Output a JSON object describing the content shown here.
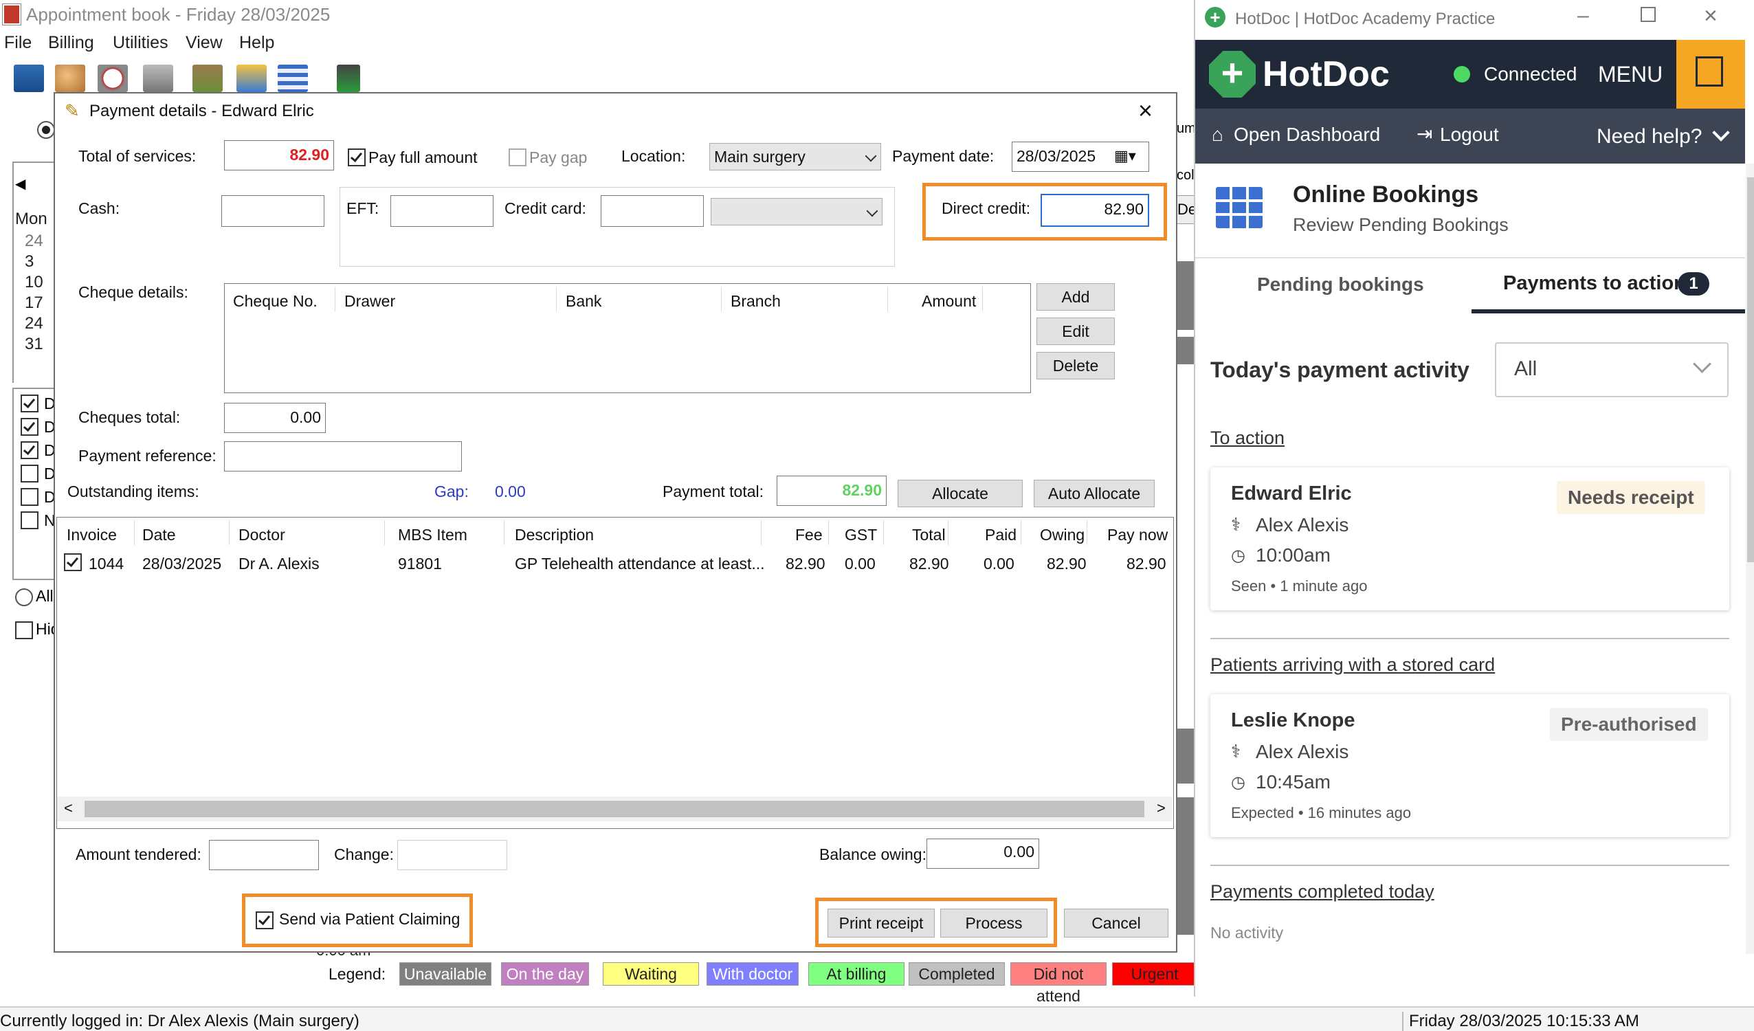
{
  "app": {
    "title": "Appointment book - Friday 28/03/2025",
    "menu": [
      "File",
      "Billing",
      "Utilities",
      "View",
      "Help"
    ],
    "calendar": {
      "day_label": "Mon",
      "dates": [
        "24",
        "3",
        "10",
        "17",
        "24",
        "31"
      ]
    },
    "filters": {
      "item_initial": "D",
      "last_initial": "N",
      "all_label": "All",
      "hide_label": "Hid"
    },
    "right_partial": {
      "a": "umi",
      "b": "colu",
      "c": "De"
    },
    "status_left": "Currently logged in: Dr Alex Alexis (Main surgery)",
    "status_right": "Friday 28/03/2025 10:15:33 AM",
    "legend_label": "Legend:",
    "legend": [
      {
        "label": "Unavailable",
        "bg": "#808080",
        "fg": "#ffffff"
      },
      {
        "label": "On the day",
        "bg": "#c080c0",
        "fg": "#ffffff"
      },
      {
        "label": "Waiting",
        "bg": "#ffff80",
        "fg": "#222222"
      },
      {
        "label": "With doctor",
        "bg": "#8080ff",
        "fg": "#ffffff"
      },
      {
        "label": "At billing",
        "bg": "#80ff80",
        "fg": "#222222"
      },
      {
        "label": "Completed",
        "bg": "#c0c0c0",
        "fg": "#222222"
      },
      {
        "label": "Did not attend",
        "bg": "#ff8080",
        "fg": "#222222"
      },
      {
        "label": "Urgent",
        "bg": "#ff0000",
        "fg": "#222222"
      }
    ],
    "behind_time": "0:00 am"
  },
  "dialog": {
    "title": "Payment details - Edward Elric",
    "total_services_label": "Total of services:",
    "total_services_value": "82.90",
    "pay_full_label": "Pay full amount",
    "pay_gap_label": "Pay gap",
    "location_label": "Location:",
    "location_value": "Main surgery",
    "payment_date_label": "Payment date:",
    "payment_date_value": "28/03/2025",
    "cash_label": "Cash:",
    "eft_label": "EFT:",
    "credit_card_label": "Credit card:",
    "direct_credit_label": "Direct credit:",
    "direct_credit_value": "82.90",
    "cheque_details_label": "Cheque details:",
    "cheque_columns": [
      "Cheque No.",
      "Drawer",
      "Bank",
      "Branch",
      "Amount"
    ],
    "cheque_buttons": {
      "add": "Add",
      "edit": "Edit",
      "delete": "Delete"
    },
    "cheques_total_label": "Cheques total:",
    "cheques_total_value": "0.00",
    "payment_reference_label": "Payment reference:",
    "outstanding_label": "Outstanding items:",
    "gap_label": "Gap:",
    "gap_value": "0.00",
    "payment_total_label": "Payment total:",
    "payment_total_value": "82.90",
    "allocate_label": "Allocate",
    "auto_allocate_label": "Auto Allocate",
    "invoice_columns": [
      "Invoice",
      "Date",
      "Doctor",
      "MBS Item",
      "Description",
      "Fee",
      "GST",
      "Total",
      "Paid",
      "Owing",
      "Pay now"
    ],
    "invoice_rows": [
      {
        "invoice": "1044",
        "date": "28/03/2025",
        "doctor": "Dr A. Alexis",
        "mbs": "91801",
        "description": "GP Telehealth attendance at least...",
        "fee": "82.90",
        "gst": "0.00",
        "total": "82.90",
        "paid": "0.00",
        "owing": "82.90",
        "pay_now": "82.90"
      }
    ],
    "amount_tendered_label": "Amount tendered:",
    "change_label": "Change:",
    "balance_owing_label": "Balance owing:",
    "balance_owing_value": "0.00",
    "send_patient_claiming_label": "Send via Patient Claiming",
    "print_receipt_label": "Print receipt",
    "process_label": "Process",
    "cancel_label": "Cancel"
  },
  "hotdoc": {
    "window_title": "HotDoc | HotDoc Academy Practice",
    "brand": "HotDoc",
    "connected": "Connected",
    "menu": "MENU",
    "open_dashboard": "Open Dashboard",
    "logout": "Logout",
    "need_help": "Need help?",
    "section_title": "Online Bookings",
    "section_subtitle": "Review Pending Bookings",
    "tab_pending": "Pending bookings",
    "tab_payments": "Payments to action",
    "tab_payments_count": "1",
    "activity_label": "Today's payment activity",
    "activity_filter": "All",
    "to_action_label": "To action",
    "card1": {
      "name": "Edward Elric",
      "doctor": "Alex Alexis",
      "time": "10:00am",
      "meta": "Seen • 1 minute ago",
      "status": "Needs receipt"
    },
    "stored_card_label": "Patients arriving with a stored card",
    "card2": {
      "name": "Leslie Knope",
      "doctor": "Alex Alexis",
      "time": "10:45am",
      "meta": "Expected • 16 minutes ago",
      "status": "Pre-authorised"
    },
    "completed_label": "Payments completed today",
    "no_activity": "No activity",
    "colors": {
      "nav": "#1f2937",
      "subnav": "#3d4554",
      "accent": "#f5a623",
      "connected": "#4cd964",
      "needs_receipt_bg": "#fdf3e2",
      "preauth_bg": "#f2f2f2"
    }
  }
}
